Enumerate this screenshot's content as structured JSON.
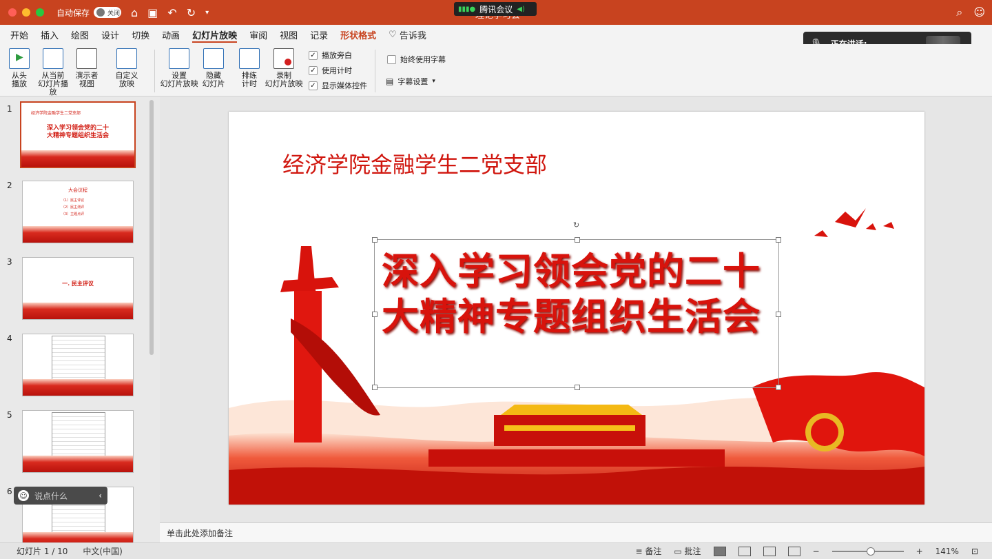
{
  "titlebar": {
    "autosave_label": "自动保存",
    "autosave_state": "关闭",
    "meeting_label": "腾讯会议",
    "doc_title": "理论学习会"
  },
  "tabs": [
    "开始",
    "插入",
    "绘图",
    "设计",
    "切换",
    "动画",
    "幻灯片放映",
    "审阅",
    "视图",
    "记录",
    "形状格式",
    "告诉我"
  ],
  "active_tab": "幻灯片放映",
  "ribbon": {
    "play_from_start": [
      "从头",
      "播放"
    ],
    "play_from_current": [
      "从当前",
      "幻灯片播放"
    ],
    "presenter_view": [
      "演示者",
      "视图"
    ],
    "custom_show": [
      "自定义",
      "放映"
    ],
    "setup_show": [
      "设置",
      "幻灯片放映"
    ],
    "hide_slide": [
      "隐藏",
      "幻灯片"
    ],
    "rehearse": [
      "排练",
      "计时"
    ],
    "record": [
      "录制",
      "幻灯片放映"
    ],
    "checkboxes": [
      {
        "label": "播放旁白",
        "checked": true
      },
      {
        "label": "使用计时",
        "checked": true
      },
      {
        "label": "显示媒体控件",
        "checked": true
      }
    ],
    "always_subtitles": "始终使用字幕",
    "subtitle_settings": "字幕设置"
  },
  "speaking": {
    "label": "正在讲话:"
  },
  "thumbnails": [
    {
      "num": "1",
      "title": "深入学习领会党的二十大精神专题组织生活会",
      "header": "经济学院金融学生二党支部"
    },
    {
      "num": "2",
      "title": "大会议程",
      "lines": [
        "（1）民主评议",
        "（2）民主测评",
        "（3）主题点评"
      ]
    },
    {
      "num": "3",
      "title": "一. 民主评议"
    },
    {
      "num": "4"
    },
    {
      "num": "5"
    },
    {
      "num": "6"
    }
  ],
  "saybar": {
    "placeholder": "说点什么"
  },
  "slide": {
    "header": "经济学院金融学生二党支部",
    "title_line1": "深入学习领会党的二十",
    "title_line2": "大精神专题组织生活会"
  },
  "notes_placeholder": "单击此处添加备注",
  "status": {
    "slide_info": "幻灯片 1 / 10",
    "language": "中文(中国)",
    "notes_btn": "备注",
    "comments_btn": "批注",
    "zoom": "141%"
  },
  "colors": {
    "accent": "#c8431f",
    "slide_red": "#d8130c"
  }
}
